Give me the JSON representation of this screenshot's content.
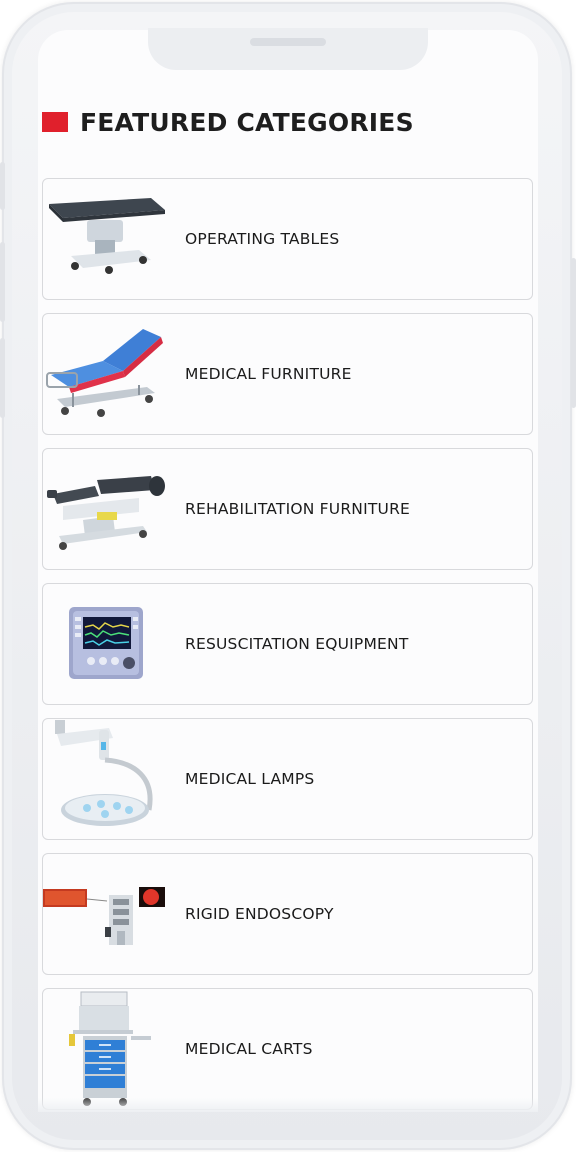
{
  "header": {
    "title": "FEATURED CATEGORIES",
    "accent_color": "#e0202c"
  },
  "categories": [
    {
      "label": "OPERATING TABLES",
      "icon": "operating-table-image"
    },
    {
      "label": "MEDICAL FURNITURE",
      "icon": "hospital-bed-image"
    },
    {
      "label": "REHABILITATION FURNITURE",
      "icon": "rehab-table-image"
    },
    {
      "label": "RESUSCITATION EQUIPMENT",
      "icon": "ventilator-monitor-image"
    },
    {
      "label": "MEDICAL LAMPS",
      "icon": "surgical-lamp-image"
    },
    {
      "label": "RIGID ENDOSCOPY",
      "icon": "endoscopy-tower-image"
    },
    {
      "label": "MEDICAL CARTS",
      "icon": "medical-cart-image"
    }
  ]
}
